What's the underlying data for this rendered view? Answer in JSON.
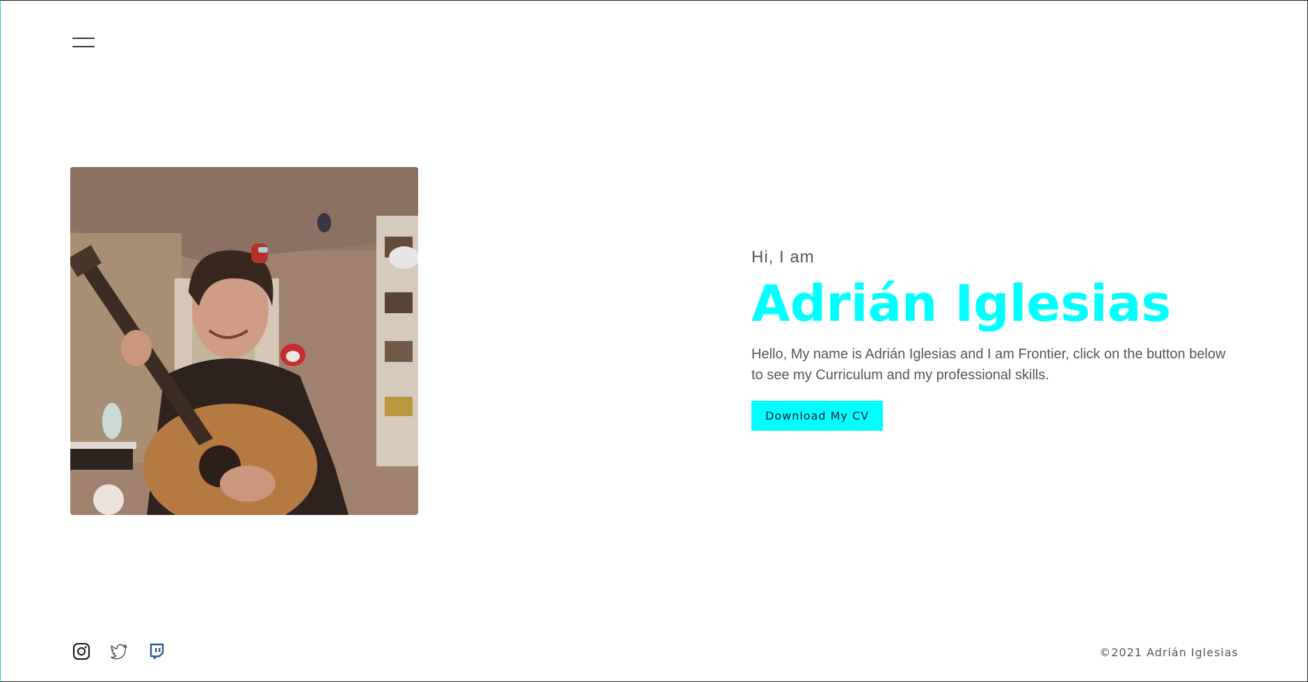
{
  "nav": {
    "menu_icon": "hamburger-menu-icon"
  },
  "profile_photo": {
    "alt": "Photo of Adrián Iglesias holding a guitar"
  },
  "intro": {
    "greeting": "Hi, I am",
    "name": "Adrián Iglesias",
    "description": "Hello, My name is Adrián Iglesias and I am Frontier, click on the button below to see my Curriculum and my professional skills.",
    "cv_button_label": "Download My CV"
  },
  "footer": {
    "social_icons": [
      "instagram-icon",
      "twitter-icon",
      "twitch-icon"
    ],
    "copyright": "©2021 Adrián Iglesias"
  },
  "colors": {
    "accent": "#00ffff",
    "text": "#555555",
    "twitch": "#2d5a8c"
  }
}
